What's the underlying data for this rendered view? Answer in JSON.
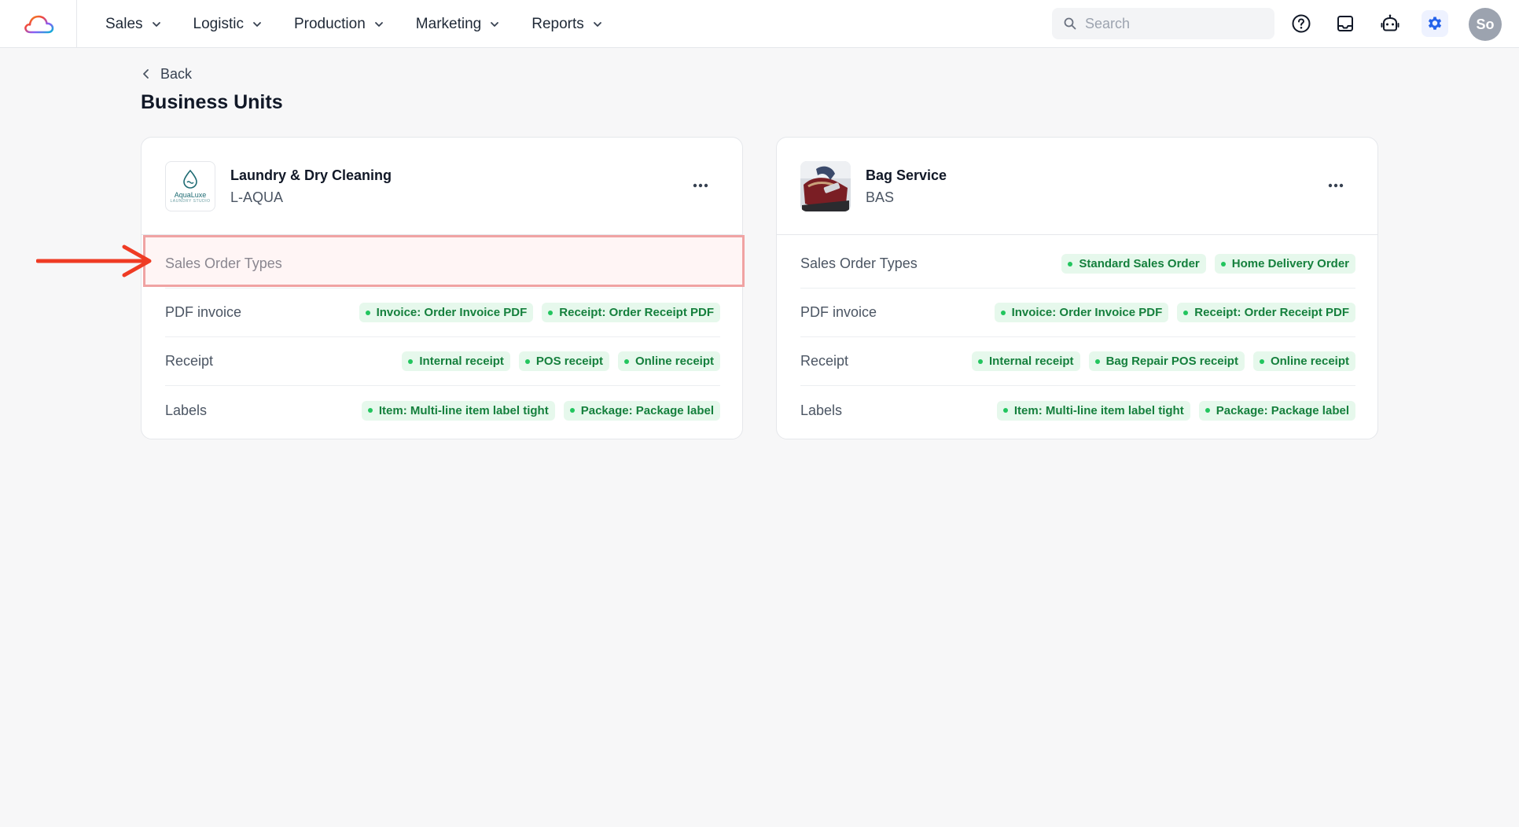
{
  "nav": {
    "items": [
      {
        "label": "Sales"
      },
      {
        "label": "Logistic"
      },
      {
        "label": "Production"
      },
      {
        "label": "Marketing"
      },
      {
        "label": "Reports"
      }
    ]
  },
  "search": {
    "placeholder": "Search"
  },
  "user": {
    "initials": "So"
  },
  "page": {
    "back_label": "Back",
    "title": "Business Units"
  },
  "cards": [
    {
      "name": "Laundry & Dry Cleaning",
      "code": "L-AQUA",
      "logo_text": "AquaLuxe",
      "logo_sub": "LAUNDRY STUDIO",
      "rows": [
        {
          "label": "Sales Order Types",
          "tags": []
        },
        {
          "label": "PDF invoice",
          "tags": [
            "Invoice: Order Invoice PDF",
            "Receipt: Order Receipt PDF"
          ]
        },
        {
          "label": "Receipt",
          "tags": [
            "Internal receipt",
            "POS receipt",
            "Online receipt"
          ]
        },
        {
          "label": "Labels",
          "tags": [
            "Item: Multi-line item label tight",
            "Package: Package label"
          ]
        }
      ]
    },
    {
      "name": "Bag Service",
      "code": "BAS",
      "rows": [
        {
          "label": "Sales Order Types",
          "tags": [
            "Standard Sales Order",
            "Home Delivery Order"
          ]
        },
        {
          "label": "PDF invoice",
          "tags": [
            "Invoice: Order Invoice PDF",
            "Receipt: Order Receipt PDF"
          ]
        },
        {
          "label": "Receipt",
          "tags": [
            "Internal receipt",
            "Bag Repair POS receipt",
            "Online receipt"
          ]
        },
        {
          "label": "Labels",
          "tags": [
            "Item: Multi-line item label tight",
            "Package: Package label"
          ]
        }
      ]
    }
  ],
  "colors": {
    "tag_bg": "#e6f8ec",
    "tag_text": "#15803d",
    "accent": "#2563eb",
    "annotation": "#ef3b24"
  }
}
